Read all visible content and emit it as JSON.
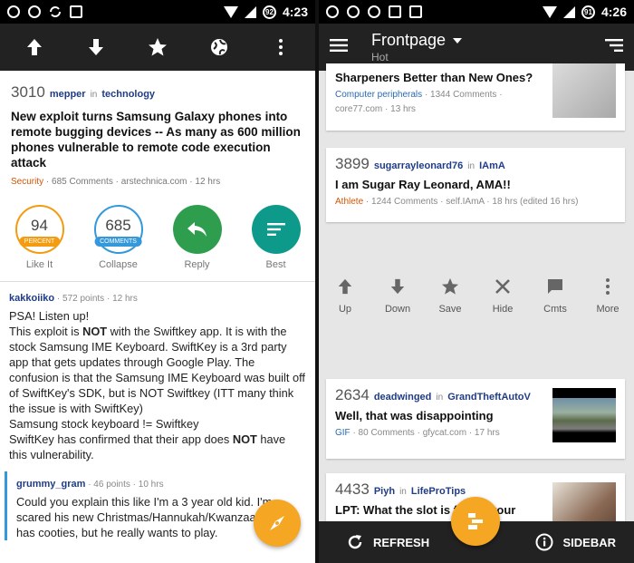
{
  "left": {
    "status": {
      "battery": "92",
      "time": "4:23"
    },
    "post": {
      "score": "3010",
      "user": "mepper",
      "in": "in",
      "subreddit": "technology",
      "title": "New exploit turns Samsung Galaxy phones into remote bugging devices -- As many as 600 million phones vulnerable to remote code execution attack",
      "flair": "Security",
      "info": "· 685 Comments · arstechnica.com · 12 hrs"
    },
    "actions": {
      "percent_value": "94",
      "percent_badge": "PERCENT",
      "percent_label": "Like It",
      "comments_value": "685",
      "comments_badge": "COMMENTS",
      "comments_label": "Collapse",
      "reply_label": "Reply",
      "best_label": "Best"
    },
    "comment1": {
      "user": "kakkoiiko",
      "meta": "· 572 points · 12 hrs",
      "line1": "PSA! Listen up!",
      "p1a": "This exploit is ",
      "p1b": "NOT",
      "p1c": " with the Swiftkey app. It is with the stock Samsung IME Keyboard. SwiftKey is a 3rd party app that gets updates through Google Play. The confusion is that the Samsung IME Keyboard was built off of SwiftKey's SDK, but is NOT Swiftkey (ITT many think the issue is with SwiftKey)",
      "line3": "Samsung stock keyboard != Swiftkey",
      "p2a": "SwiftKey has confirmed that their app does ",
      "p2b": "NOT",
      "p2c": " have this vulnerability."
    },
    "comment2": {
      "user": "grummy_gram",
      "meta": "· 46 points · 10 hrs",
      "body": "Could you explain this like I'm a 3 year old kid. I'm scared his new Christmas/Hannukah/Kwanzaa present has cooties, but he really wants to play."
    }
  },
  "right": {
    "status": {
      "battery": "91",
      "time": "4:26"
    },
    "toolbar": {
      "title": "Frontpage",
      "subtitle": "Hot"
    },
    "card0": {
      "title": "Sharpeners Better than New Ones?",
      "flair": "Computer peripherals",
      "info": "· 1344 Comments ·",
      "domain": "core77.com · 13 hrs"
    },
    "card1": {
      "score": "3899",
      "user": "sugarrayleonard76",
      "in": "in",
      "subreddit": "IAmA",
      "title": "I am Sugar Ray Leonard, AMA!!",
      "flair": "Athlete",
      "info": "· 1244 Comments · self.IAmA · 18 hrs (edited 16 hrs)"
    },
    "actions": {
      "up": "Up",
      "down": "Down",
      "save": "Save",
      "hide": "Hide",
      "cmts": "Cmts",
      "more": "More"
    },
    "card2": {
      "score": "2634",
      "user": "deadwinged",
      "in": "in",
      "subreddit": "GrandTheftAutoV",
      "title": "Well, that was disappointing",
      "flair": "GIF",
      "info": "· 80 Comments · gfycat.com · 17 hrs"
    },
    "card3": {
      "score": "4433",
      "user": "Piyh",
      "in": "in",
      "subreddit": "LifeProTips",
      "title": "LPT: What the slot is for on your"
    },
    "bottombar": {
      "refresh": "REFRESH",
      "sidebar": "SIDEBAR"
    }
  }
}
